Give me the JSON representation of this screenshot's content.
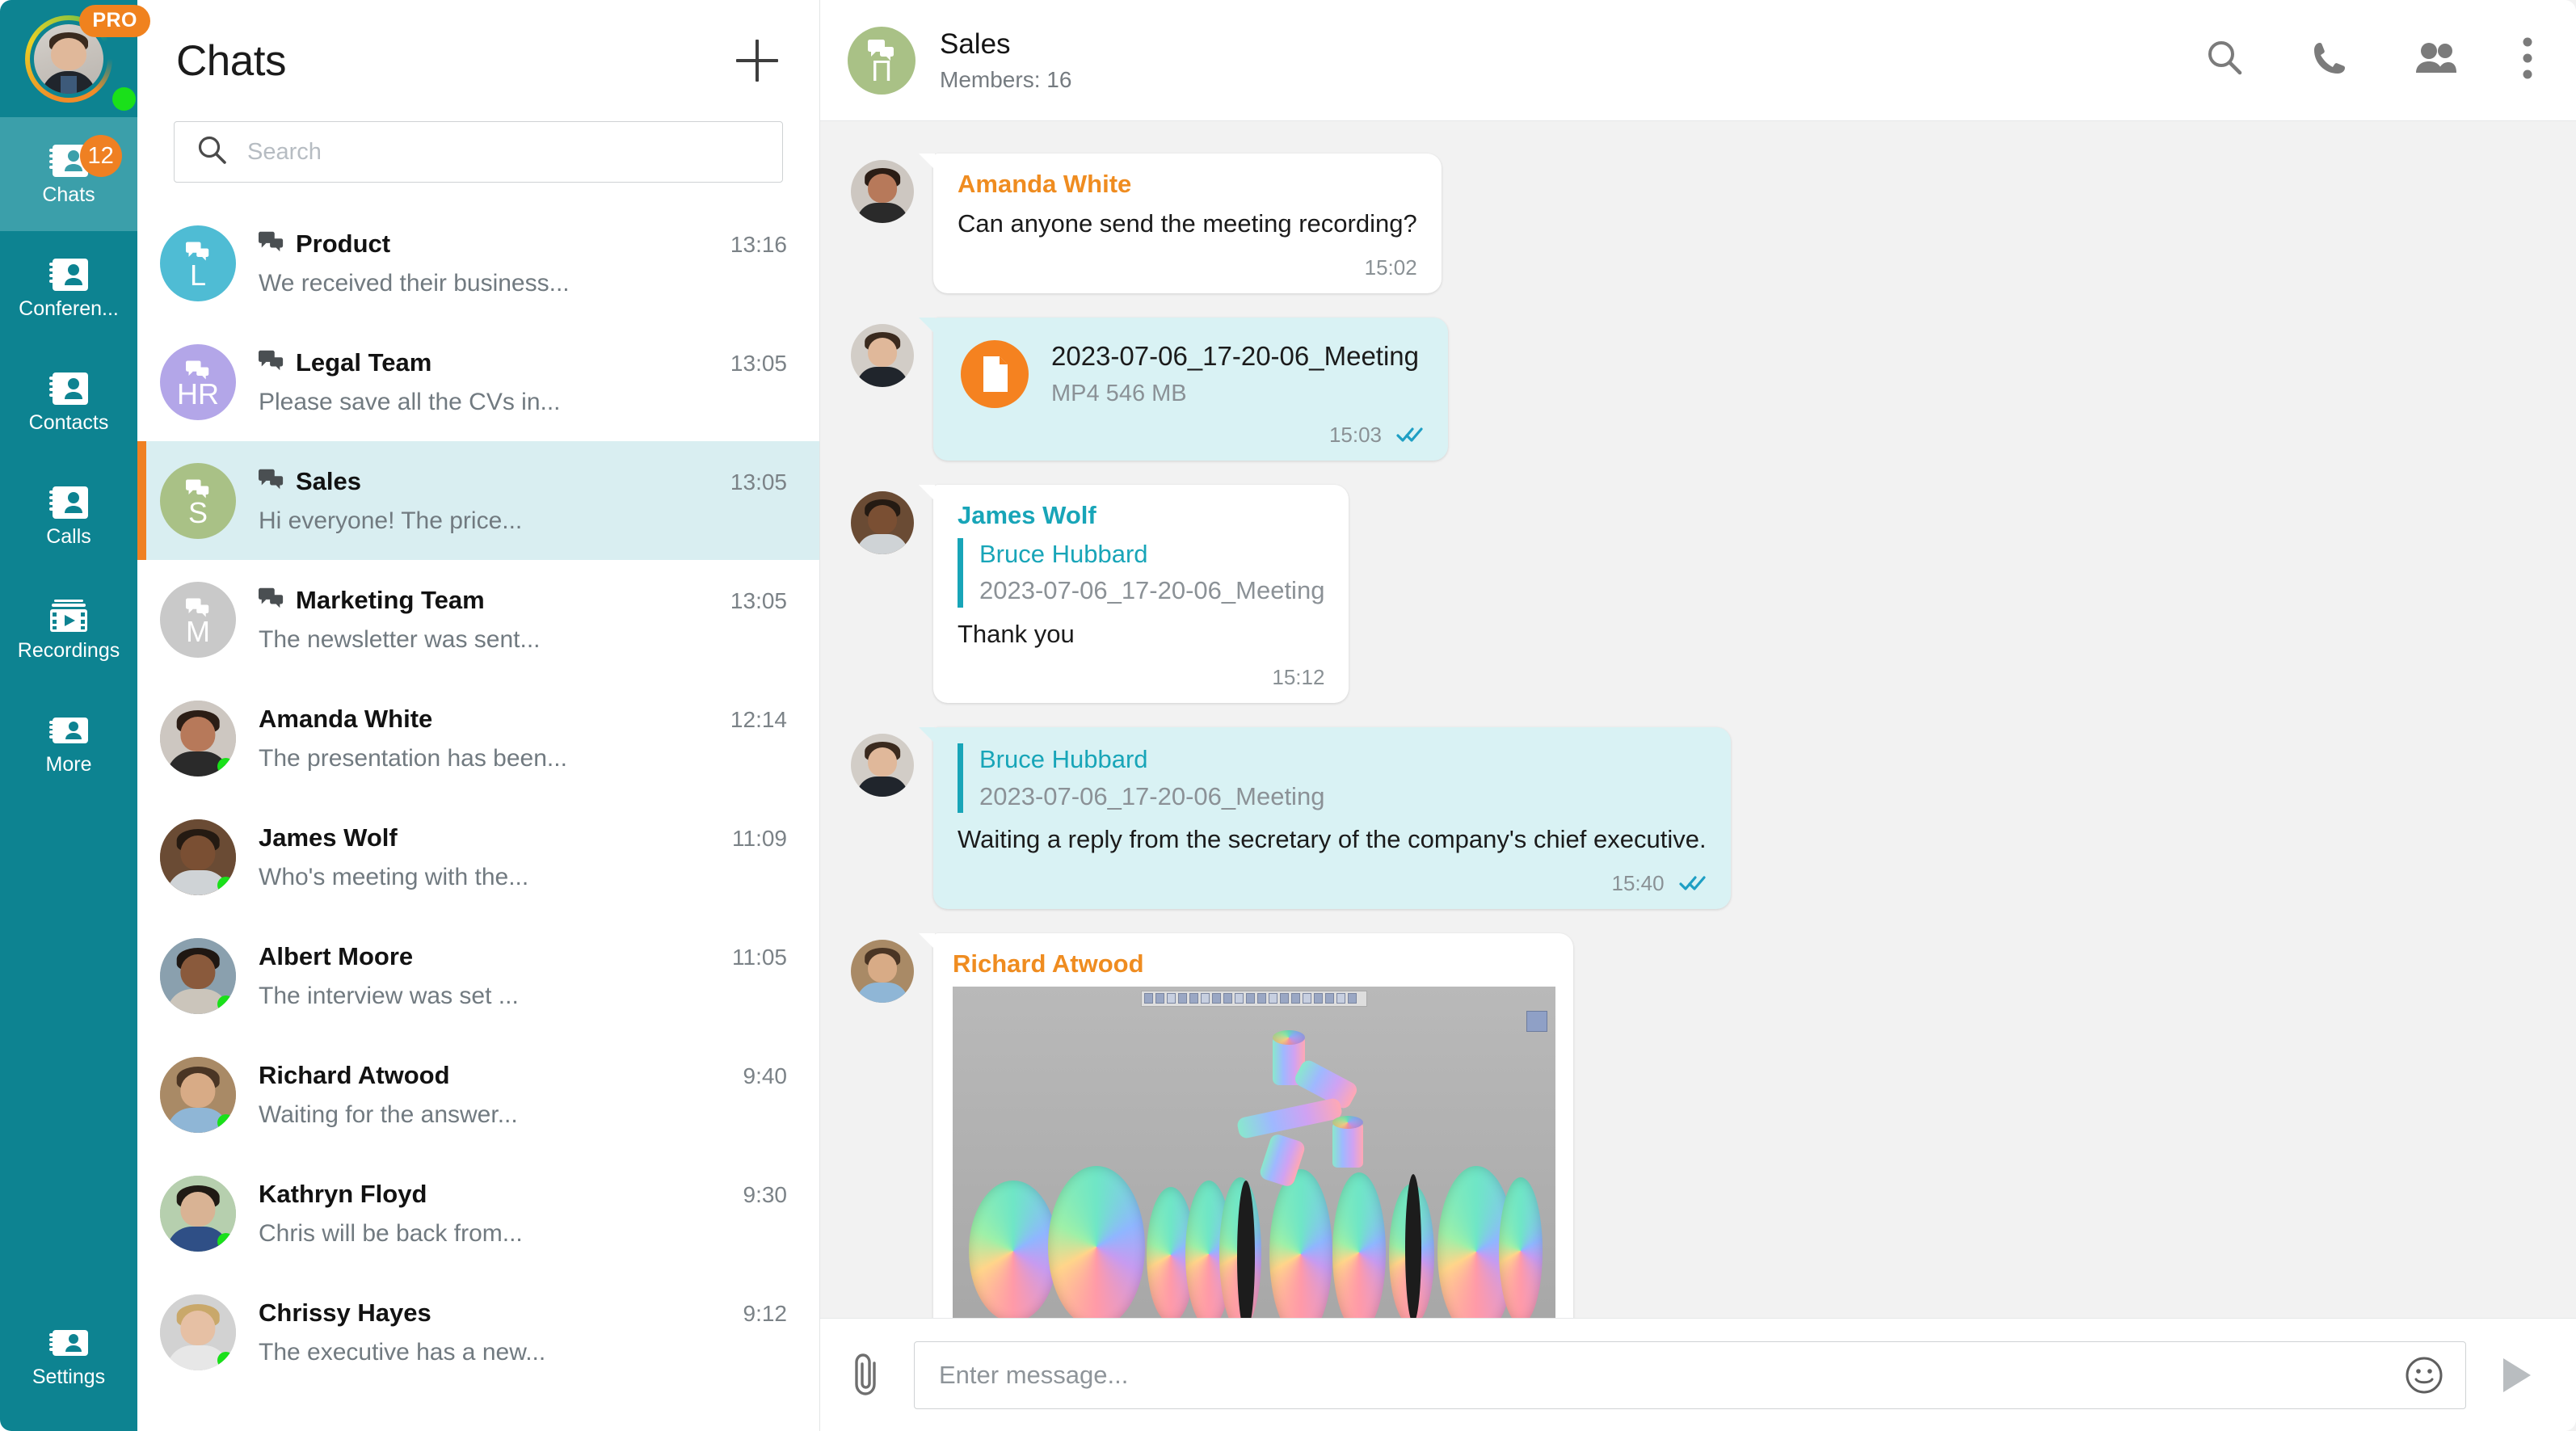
{
  "rail": {
    "profile": {
      "badge": "PRO",
      "status": "online"
    },
    "items": [
      {
        "label": "Chats",
        "icon": "contact-card-icon",
        "badge": "12",
        "active": true
      },
      {
        "label": "Conferen...",
        "icon": "contact-card-icon",
        "badge": "",
        "active": false
      },
      {
        "label": "Contacts",
        "icon": "contact-card-icon",
        "badge": "",
        "active": false
      },
      {
        "label": "Calls",
        "icon": "contact-card-icon",
        "badge": "",
        "active": false
      },
      {
        "label": "Recordings",
        "icon": "film-play-icon",
        "badge": "",
        "active": false
      },
      {
        "label": "More",
        "icon": "contact-card-icon",
        "badge": "",
        "active": false
      }
    ],
    "settings": {
      "label": "Settings",
      "icon": "contact-card-icon"
    },
    "colors": {
      "bg": "#0d8391",
      "active_bg": "#3b9faa",
      "badge": "#ef8022",
      "online": "#1ae01a"
    }
  },
  "chat_list": {
    "title": "Chats",
    "new_chat_label": "+",
    "search": {
      "placeholder": "Search",
      "value": "",
      "icon": "search-icon"
    },
    "rows": [
      {
        "name": "Product",
        "preview": "We received their business...",
        "time": "13:16",
        "initial": "L",
        "avatar_color": "#4fbcd4",
        "group": true,
        "online": false,
        "selected": false
      },
      {
        "name": "Legal Team",
        "preview": "Please save all the CVs in...",
        "time": "13:05",
        "initial": "HR",
        "avatar_color": "#b3a6e8",
        "group": true,
        "online": false,
        "selected": false
      },
      {
        "name": "Sales",
        "preview": "Hi everyone! The price...",
        "time": "13:05",
        "initial": "S",
        "avatar_color": "#a9c186",
        "group": true,
        "online": false,
        "selected": true
      },
      {
        "name": "Marketing Team",
        "preview": "The newsletter was sent...",
        "time": "13:05",
        "initial": "M",
        "avatar_color": "#c9c9c9",
        "group": true,
        "online": false,
        "selected": false
      },
      {
        "name": "Amanda White",
        "preview": "The presentation has been...",
        "time": "12:14",
        "initial": "",
        "avatar_color": "#b8b0a8",
        "group": false,
        "online": true,
        "selected": false
      },
      {
        "name": "James Wolf",
        "preview": "Who's meeting with the...",
        "time": "11:09",
        "initial": "",
        "avatar_color": "#8a6a4e",
        "group": false,
        "online": true,
        "selected": false
      },
      {
        "name": "Albert Moore",
        "preview": "The interview was set ...",
        "time": "11:05",
        "initial": "",
        "avatar_color": "#9fb0bd",
        "group": false,
        "online": true,
        "selected": false
      },
      {
        "name": "Richard Atwood",
        "preview": "Waiting for the answer...",
        "time": "9:40",
        "initial": "",
        "avatar_color": "#c0a080",
        "group": false,
        "online": true,
        "selected": false
      },
      {
        "name": "Kathryn Floyd",
        "preview": "Chris will be back from...",
        "time": "9:30",
        "initial": "",
        "avatar_color": "#a9bfa0",
        "group": false,
        "online": true,
        "selected": false
      },
      {
        "name": "Chrissy Hayes",
        "preview": "The executive has a new...",
        "time": "9:12",
        "initial": "",
        "avatar_color": "#cfcfcf",
        "group": false,
        "online": true,
        "selected": false
      }
    ],
    "colors": {
      "selected_bg": "#d9eef1",
      "selected_bar": "#ef8022"
    }
  },
  "conversation": {
    "header": {
      "title": "Sales",
      "subtitle": "Members: 16",
      "avatar_initial": "П",
      "avatar_color": "#a9c186",
      "actions": [
        {
          "name": "search-icon",
          "label": "Search"
        },
        {
          "name": "phone-icon",
          "label": "Call"
        },
        {
          "name": "members-icon",
          "label": "Members"
        },
        {
          "name": "more-vertical-icon",
          "label": "More options"
        }
      ]
    },
    "messages": [
      {
        "type": "text",
        "direction": "in",
        "sender": "Amanda White",
        "sender_color": "#ef8c20",
        "text": "Can anyone send the meeting recording?",
        "time": "15:02",
        "read": false
      },
      {
        "type": "file",
        "direction": "out",
        "sender": "",
        "file_name": "2023-07-06_17-20-06_Meeting",
        "file_meta": "MP4 546 MB",
        "file_icon": "document-icon",
        "time": "15:03",
        "read": true
      },
      {
        "type": "quote",
        "direction": "in",
        "sender": "James Wolf",
        "sender_color": "#18a5b8",
        "quote_name": "Bruce Hubbard",
        "quote_text": "2023-07-06_17-20-06_Meeting",
        "text": "Thank you",
        "time": "15:12",
        "read": false
      },
      {
        "type": "quote",
        "direction": "out",
        "sender": "",
        "quote_name": "Bruce Hubbard",
        "quote_text": "2023-07-06_17-20-06_Meeting",
        "text": "Waiting a reply from the secretary of the company's chief executive.",
        "time": "15:40",
        "read": true
      },
      {
        "type": "image",
        "direction": "in",
        "sender": "Richard Atwood",
        "sender_color": "#ef8c20",
        "image_alt": "CAD exploded view of a turbine engine assembly",
        "time": "",
        "read": false
      }
    ]
  },
  "composer": {
    "attach_label": "Attach file",
    "attach_icon": "paperclip-icon",
    "input": {
      "placeholder": "Enter message...",
      "value": ""
    },
    "emoji_icon": "smiley-icon",
    "send_icon": "send-icon"
  }
}
